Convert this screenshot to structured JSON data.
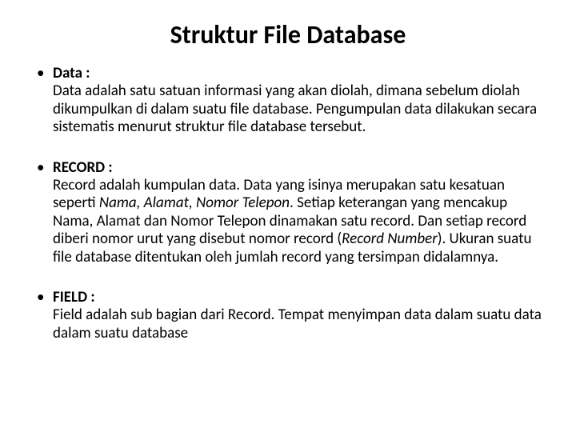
{
  "title": "Struktur File Database",
  "items": [
    {
      "term": "Data :",
      "body_parts": [
        {
          "text": "Data adalah satu satuan informasi yang akan diolah, dimana sebelum diolah dikumpulkan di dalam suatu file database. Pengumpulan data dilakukan secara sistematis menurut struktur file database tersebut.",
          "italic": false
        }
      ]
    },
    {
      "term": "RECORD :",
      "body_parts": [
        {
          "text": "Record adalah kumpulan data. Data yang isinya merupakan satu kesatuan seperti ",
          "italic": false
        },
        {
          "text": "Nama, Alamat, Nomor Telepon",
          "italic": true
        },
        {
          "text": ". Setiap keterangan yang mencakup Nama, Alamat dan Nomor Telepon dinamakan satu record. Dan setiap record diberi nomor urut yang disebut nomor record (",
          "italic": false
        },
        {
          "text": "Record Number",
          "italic": true
        },
        {
          "text": "). Ukuran suatu file database ditentukan oleh jumlah record yang tersimpan didalamnya.",
          "italic": false
        }
      ]
    },
    {
      "term": "FIELD :",
      "body_parts": [
        {
          "text": "Field adalah sub bagian dari Record. Tempat menyimpan data dalam suatu data dalam suatu database",
          "italic": false
        }
      ]
    }
  ]
}
